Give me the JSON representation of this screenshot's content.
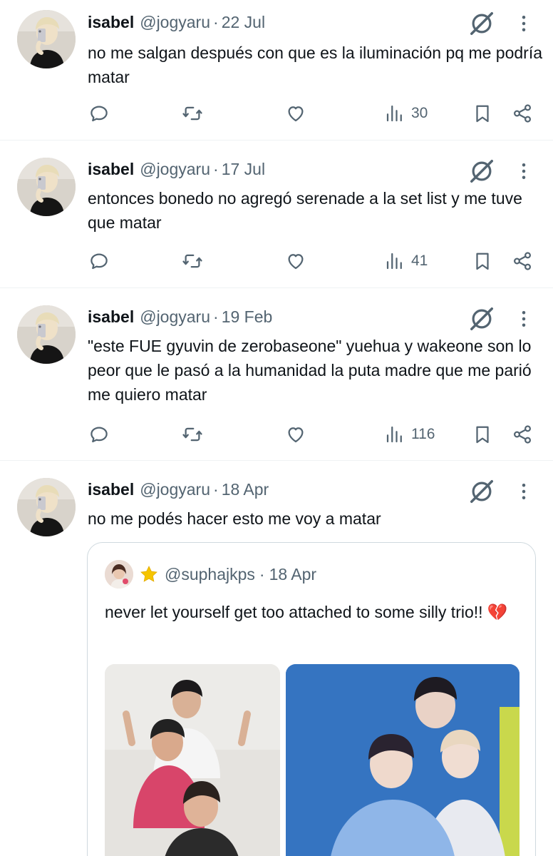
{
  "tweets": [
    {
      "name": "isabel",
      "handle": "@jogyaru",
      "date": "22 Jul",
      "text": "no me salgan después con que es la iluminación pq me podría matar",
      "views": "30"
    },
    {
      "name": "isabel",
      "handle": "@jogyaru",
      "date": "17 Jul",
      "text": "entonces bonedo no agregó serenade a la set list y me tuve que matar",
      "views": "41"
    },
    {
      "name": "isabel",
      "handle": "@jogyaru",
      "date": "19 Feb",
      "text": "\"este FUE gyuvin de zerobaseone\" yuehua y wakeone son lo peor que le pasó a la humanidad la puta madre que me parió me quiero matar",
      "views": "116"
    },
    {
      "name": "isabel",
      "handle": "@jogyaru",
      "date": "18 Apr",
      "text": "no me podés hacer esto me voy a matar",
      "quote": {
        "handle": "@suphajkps",
        "date": "18 Apr",
        "text": "never let yourself get too attached to some silly trio!! 💔"
      }
    }
  ],
  "separator": "·",
  "icons": {
    "reply": "reply-icon",
    "retweet": "retweet-icon",
    "like": "like-icon",
    "views": "views-icon",
    "bookmark": "bookmark-icon",
    "share": "share-icon",
    "grok": "grok-icon",
    "more": "more-icon",
    "star": "star-icon"
  },
  "colors": {
    "text": "#0f1419",
    "secondary": "#536471",
    "border": "#eff3f4",
    "star": "#f5c400"
  }
}
